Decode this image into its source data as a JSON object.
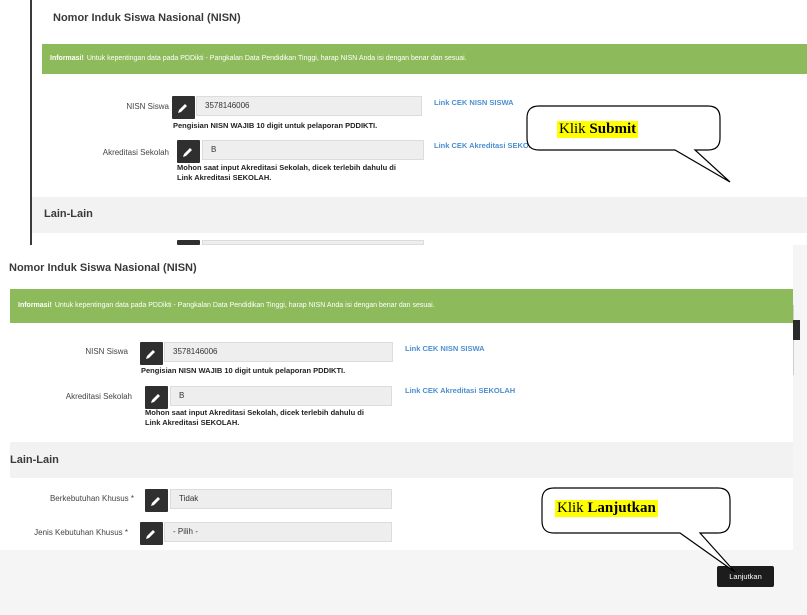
{
  "top": {
    "section_title": "Nomor Induk Siswa Nasional (NISN)",
    "info_bold": "Informasi!",
    "info_text": "Untuk kepentingan data pada PDDikti - Pangkalan Data Pendidikan Tinggi, harap NISN Anda isi dengan benar dan sesuai.",
    "nisn_label": "NISN Siswa",
    "nisn_value": "3578146006",
    "nisn_help": "Pengisian NISN WAJIB 10 digit untuk pelaporan PDDIKTI.",
    "nisn_link": "Link CEK NISN SISWA",
    "akreditasi_label": "Akreditasi Sekolah",
    "akreditasi_value": "B",
    "akreditasi_help_1": "Mohon saat input Akreditasi Sekolah, dicek terlebih dahulu di",
    "akreditasi_help_2": "Link Akreditasi SEKOLAH.",
    "akreditasi_link": "Link CEK Akreditasi SEKOLAH",
    "lain_title": "Lain-Lain"
  },
  "bottom": {
    "section_title": "Nomor Induk Siswa Nasional (NISN)",
    "info_bold": "Informasi!",
    "info_text": "Untuk kepentingan data pada PDDikti - Pangkalan Data Pendidikan Tinggi, harap NISN Anda isi dengan benar dan sesuai.",
    "nisn_label": "NISN Siswa",
    "nisn_value": "3578146006",
    "nisn_help": "Pengisian NISN WAJIB 10 digit untuk pelaporan PDDIKTI.",
    "nisn_link": "Link CEK NISN SISWA",
    "akreditasi_label": "Akreditasi Sekolah",
    "akreditasi_value": "B",
    "akreditasi_help_1": "Mohon saat input Akreditasi Sekolah, dicek terlebih dahulu di",
    "akreditasi_help_2": "Link Akreditasi SEKOLAH.",
    "akreditasi_link": "Link CEK Akreditasi SEKOLAH",
    "lain_title": "Lain-Lain",
    "berkebutuhan_label": "Berkebutuhan Khusus *",
    "berkebutuhan_value": "Tidak",
    "jenis_label": "Jenis Kebutuhan Khusus *",
    "jenis_value": "- Pilih -",
    "next_button": "Lanjutkan"
  },
  "callouts": {
    "submit_prefix": "Klik",
    "submit_bold": "Submit",
    "lanjutkan_prefix": "Klik",
    "lanjutkan_bold": "Lanjutkan"
  },
  "icons": {
    "edit": "pencil-icon"
  },
  "colors": {
    "info_green": "#8dba5a",
    "link_blue": "#4b8fd1",
    "highlight_yellow": "#ffff00",
    "button_dark": "#1c1c1c"
  }
}
